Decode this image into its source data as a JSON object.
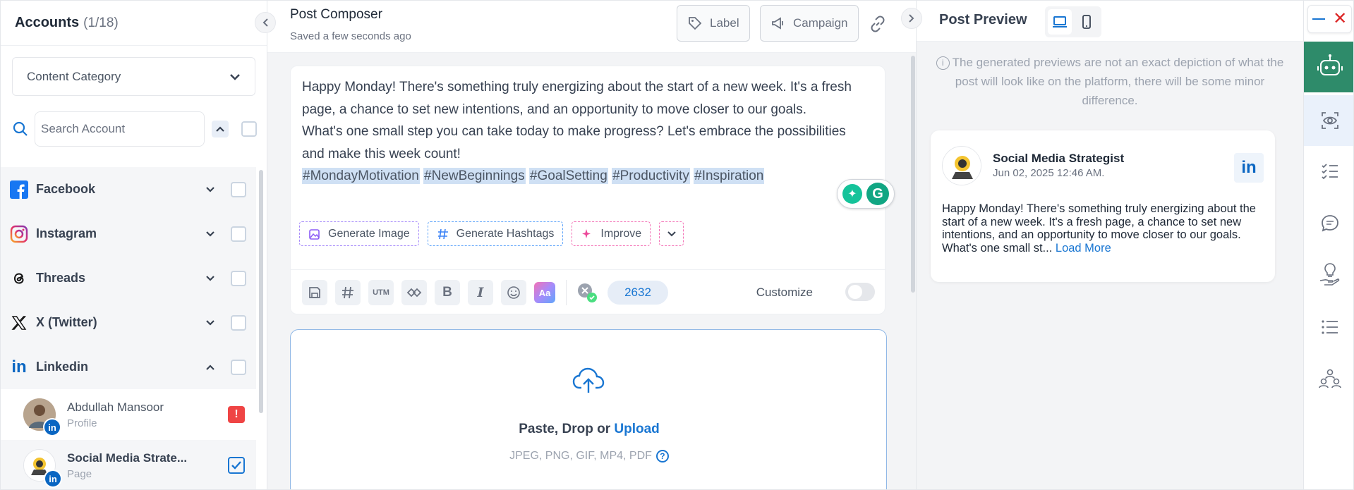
{
  "accounts": {
    "title": "Accounts",
    "count": "(1/18)",
    "category_label": "Content Category",
    "search_placeholder": "Search Account",
    "platforms": [
      {
        "name": "Facebook"
      },
      {
        "name": "Instagram"
      },
      {
        "name": "Threads"
      },
      {
        "name": "X (Twitter)"
      },
      {
        "name": "Linkedin"
      }
    ],
    "linkedin_accounts": [
      {
        "name": "Abdullah Mansoor",
        "type": "Profile"
      },
      {
        "name": "Social Media Strate...",
        "type": "Page"
      }
    ]
  },
  "composer": {
    "title": "Post Composer",
    "saved": "Saved a few seconds ago",
    "label_btn": "Label",
    "campaign_btn": "Campaign",
    "text_line1": "Happy Monday! There's something truly energizing about the start of a new week. It's a fresh page, a chance to set new intentions, and an opportunity to move closer to our goals.",
    "text_line2": "What's one small step you can take today to make progress? Let's embrace the possibilities and make this week count!",
    "hashtags": [
      "#MondayMotivation",
      "#NewBeginnings",
      "#GoalSetting",
      "#Productivity",
      "#Inspiration"
    ],
    "gen_image": "Generate Image",
    "gen_hashtags": "Generate Hashtags",
    "improve": "Improve",
    "utm": "UTM",
    "aa": "Aa",
    "char_count": "2632",
    "customize": "Customize",
    "upload_prefix": "Paste, Drop or ",
    "upload_link": "Upload",
    "upload_types": "JPEG, PNG, GIF, MP4, PDF"
  },
  "preview": {
    "title": "Post Preview",
    "note": "The generated previews are not an exact depiction of what the post will look like on the platform, there will be some minor difference.",
    "card_name": "Social Media Strategist",
    "card_date": "Jun 02, 2025 12:46 AM.",
    "card_body": "Happy Monday! There's something truly energizing about the start of a new week. It's a fresh page, a chance to set new intentions, and an opportunity to move closer to our goals.",
    "card_body2": "What's one small st...",
    "load_more": "Load More"
  },
  "colors": {
    "accent": "#1976d2",
    "linkedin": "#0a66c2",
    "bot": "#2e8b6a",
    "danger": "#ef4444"
  }
}
